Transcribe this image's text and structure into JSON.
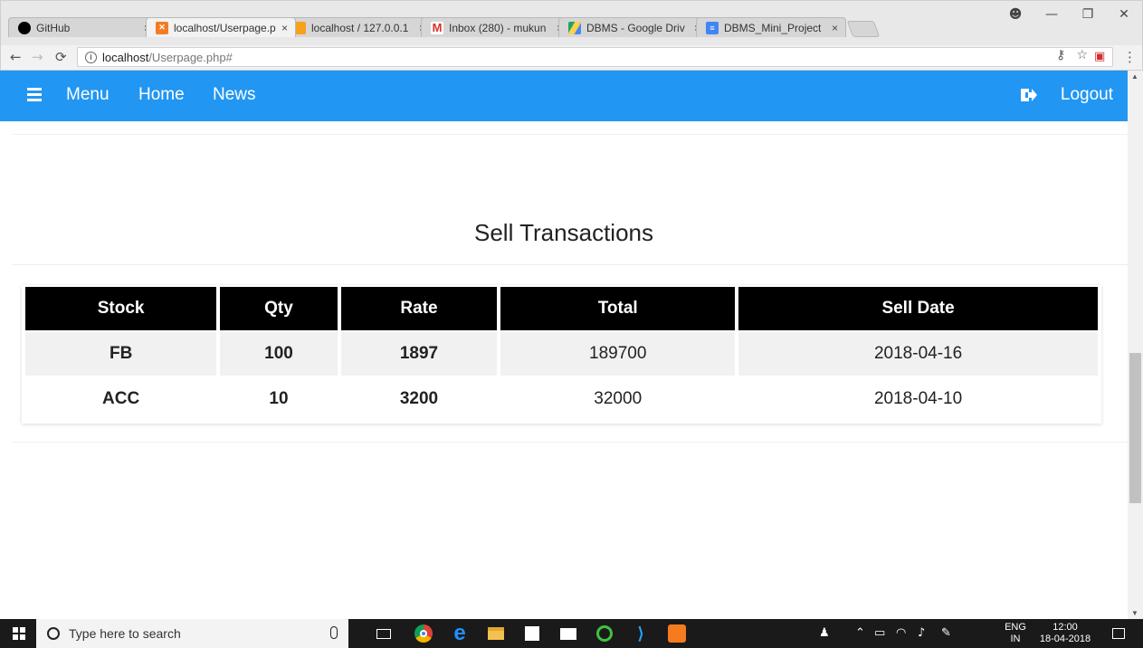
{
  "browser": {
    "tabs": [
      {
        "label": "GitHub",
        "icon": "github-icon",
        "color": "#000000"
      },
      {
        "label": "localhost/Userpage.p",
        "icon": "xampp-icon",
        "color": "#f47b20"
      },
      {
        "label": "localhost / 127.0.0.1",
        "icon": "phpmyadmin-icon",
        "color": "#f7a21b"
      },
      {
        "label": "Inbox (280) - mukun",
        "icon": "gmail-icon",
        "color": "#d93025"
      },
      {
        "label": "DBMS - Google Driv",
        "icon": "google-drive-icon",
        "color": "#1fa463"
      },
      {
        "label": "DBMS_Mini_Project",
        "icon": "google-docs-icon",
        "color": "#4285f4"
      }
    ],
    "url_host": "localhost",
    "url_path": "/Userpage.php#"
  },
  "navbar": {
    "menu_label": "Menu",
    "home_label": "Home",
    "news_label": "News",
    "logout_label": "Logout",
    "color": "#2196f3"
  },
  "page": {
    "title": "Sell Transactions",
    "table": {
      "headers": [
        "Stock",
        "Qty",
        "Rate",
        "Total",
        "Sell Date"
      ],
      "rows": [
        [
          "FB",
          "100",
          "1897",
          "189700",
          "2018-04-16"
        ],
        [
          "ACC",
          "10",
          "3200",
          "32000",
          "2018-04-10"
        ]
      ]
    }
  },
  "taskbar": {
    "search_placeholder": "Type here to search",
    "lang_top": "ENG",
    "lang_bottom": "IN",
    "time": "12:00",
    "date": "18-04-2018"
  }
}
